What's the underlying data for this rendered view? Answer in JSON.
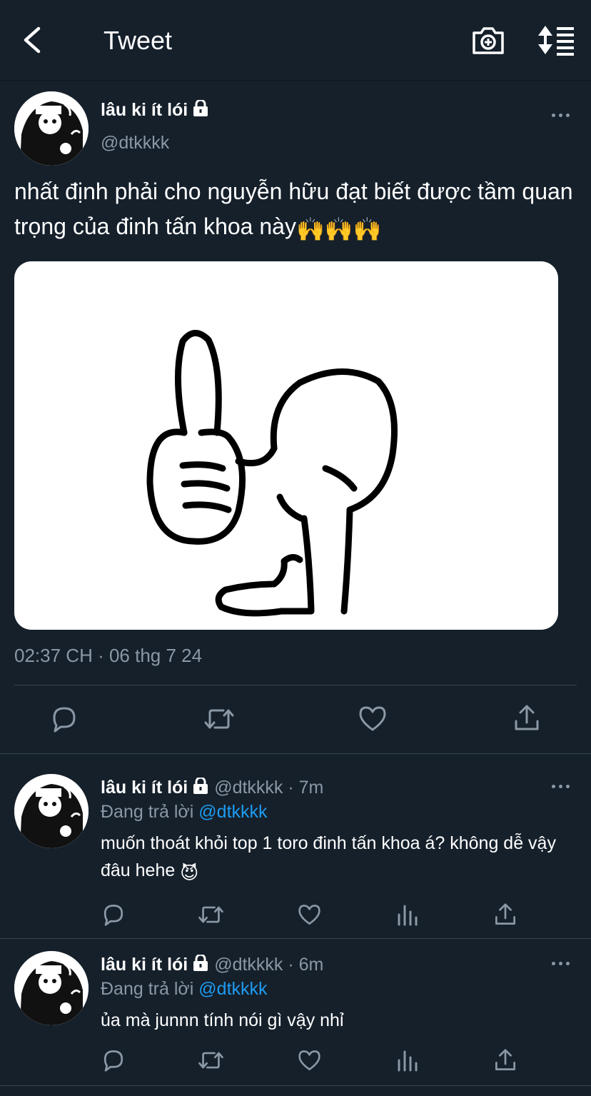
{
  "header": {
    "title": "Tweet"
  },
  "tweet": {
    "display_name": "lâu ki ít lói",
    "handle": "@dtkkkk",
    "text": "nhất định phải cho nguyễn hữu đạt biết được tầm quan trọng của đinh tấn khoa này",
    "emoji": "🙌🙌🙌",
    "timestamp": "02:37 CH · 06 thg 7 24"
  },
  "replies": [
    {
      "display_name": "lâu ki ít lói",
      "handle_time": "@dtkkkk · 7m",
      "replying_label": "Đang trả lời",
      "replying_to": "@dtkkkk",
      "text": "muốn thoát khỏi top 1 toro đinh tấn khoa á? không dễ vậy đâu hehe",
      "emoji": "😈"
    },
    {
      "display_name": "lâu ki ít lói",
      "handle_time": "@dtkkkk · 6m",
      "replying_label": "Đang trả lời",
      "replying_to": "@dtkkkk",
      "text": "ủa mà junnn tính nói gì vậy nhỉ",
      "emoji": ""
    }
  ],
  "icons": {
    "back": "chevron-left-icon",
    "camera": "camera-plus-icon",
    "sort": "sort-icon",
    "reply": "reply-icon",
    "retweet": "retweet-icon",
    "like": "heart-icon",
    "views": "views-icon",
    "share": "share-icon"
  },
  "colors": {
    "background": "#15202b",
    "muted": "#8b98a5",
    "accent": "#1d9bf0",
    "divider": "#38444d"
  }
}
